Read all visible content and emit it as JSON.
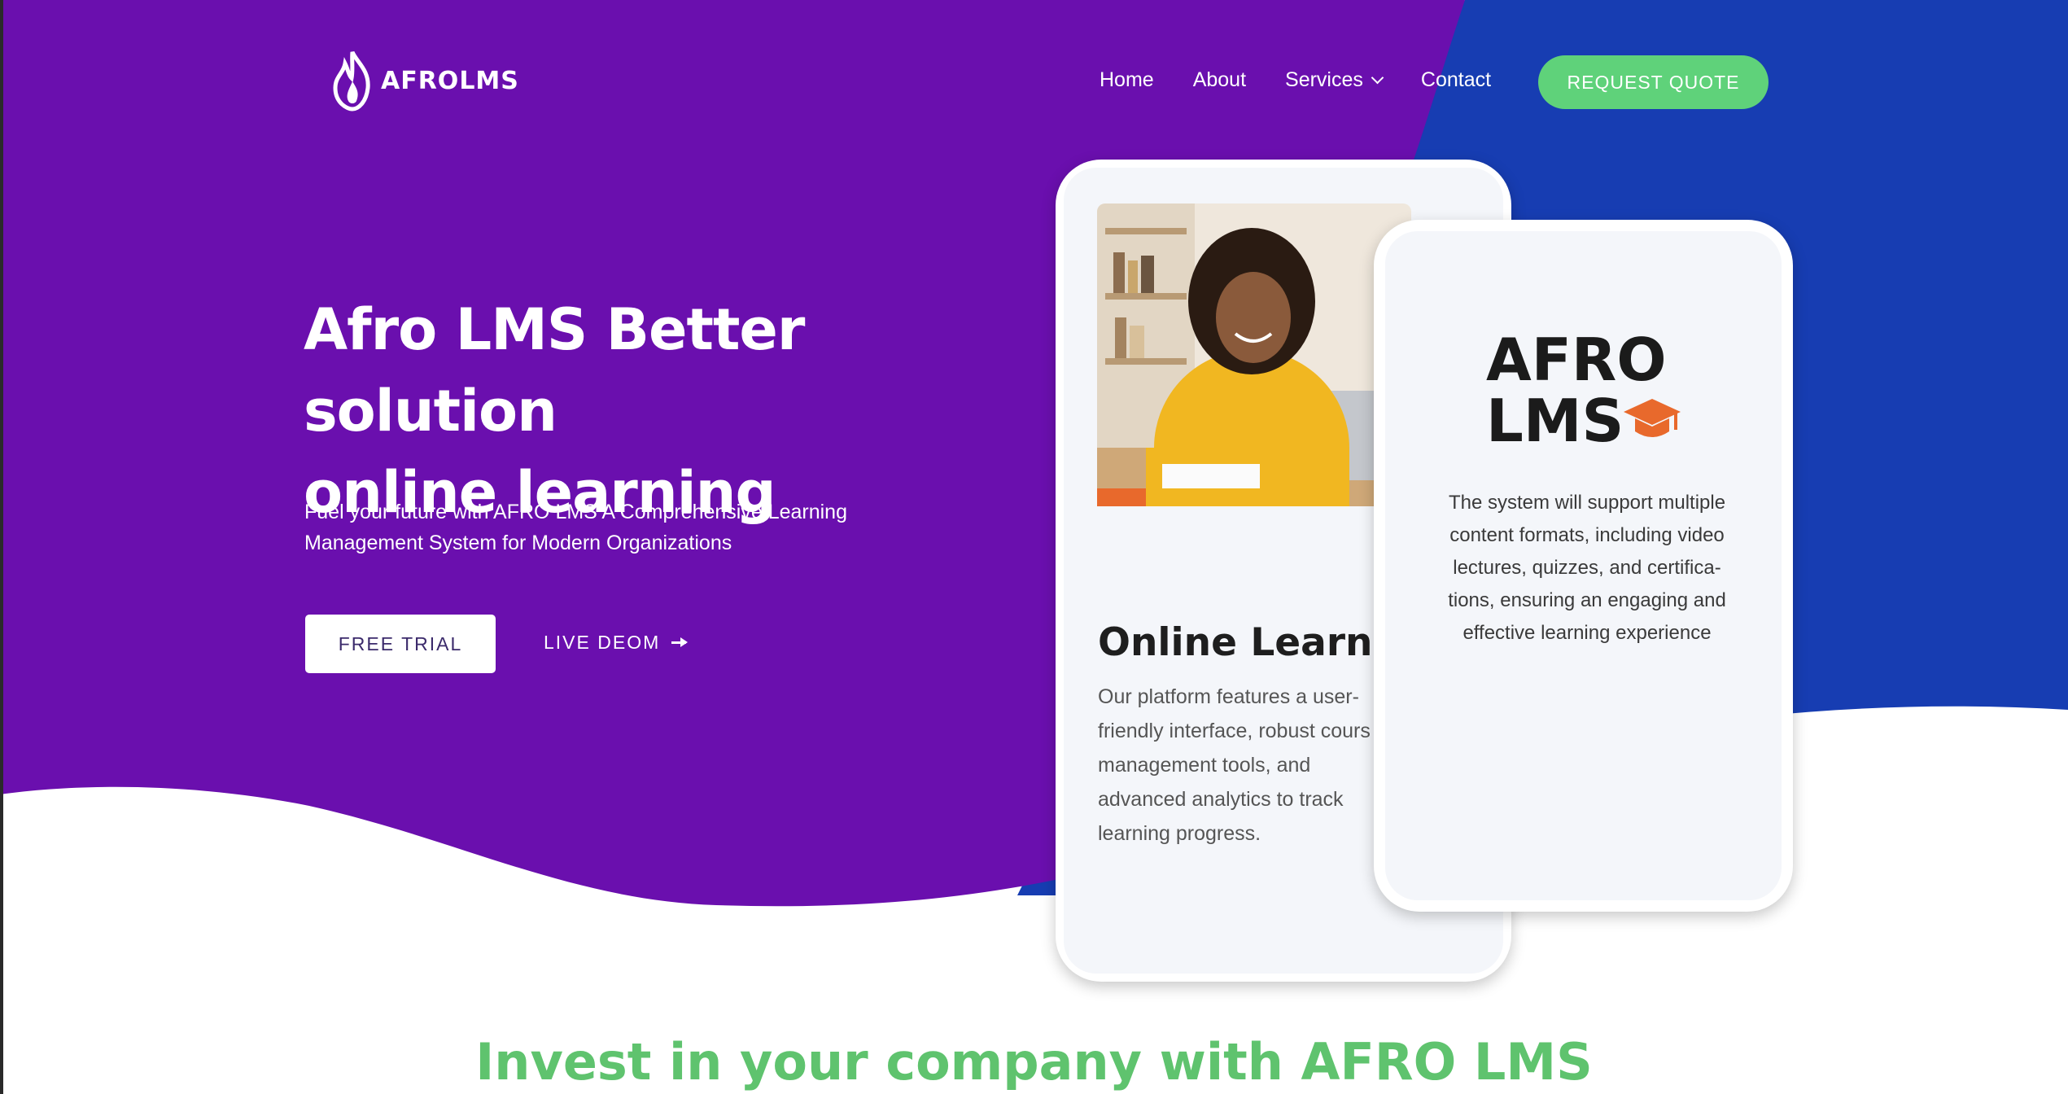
{
  "brand": {
    "name": "AFROLMS"
  },
  "nav": {
    "items": [
      {
        "label": "Home"
      },
      {
        "label": "About"
      },
      {
        "label": "Services"
      },
      {
        "label": "Contact"
      }
    ],
    "cta": "REQUEST QUOTE"
  },
  "hero": {
    "title_line1": "Afro LMS Better solution",
    "title_line2": "online learning",
    "subtitle_line1": "Fuel your future with AFRO LMS A Comprehensive Learning",
    "subtitle_line2": "Management System for Modern Organizations",
    "primary_button": "FREE TRIAL",
    "secondary_link": "LIVE DEOM"
  },
  "phone_left": {
    "heading": "Online Learning",
    "body": "Our platform features a user-\nfriendly interface, robust cours\nmanagement tools, and\nadvanced analytics to track\nlearning progress."
  },
  "phone_right": {
    "brand_line1": "AFRO",
    "brand_line2": "LMS",
    "body": "The system will support multiple\ncontent formats, including video\nlectures, quizzes, and certifica-\ntions, ensuring an engaging and\neffective learning experience"
  },
  "section": {
    "heading": "Invest in your company with AFRO LMS"
  },
  "colors": {
    "purple": "#6a0fae",
    "blue": "#173db2",
    "green": "#5fd27a",
    "heading_green": "#5fc36e"
  },
  "icons": [
    "flame-logo-icon",
    "chevron-down-icon",
    "arrow-right-icon",
    "graduation-cap-icon"
  ]
}
